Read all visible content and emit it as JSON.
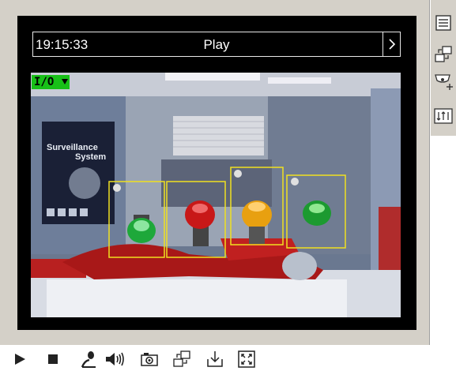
{
  "viewer": {
    "time": "19:15:33",
    "mode": "Play"
  },
  "overlay": {
    "io_label": "I/O"
  },
  "poster": {
    "line1": "Surveillance",
    "line2": "System"
  },
  "sidebar": {
    "items": [
      {
        "icon": "list-icon"
      },
      {
        "icon": "switch-window-icon"
      },
      {
        "icon": "ptz-camera-icon"
      },
      {
        "icon": "io-panel-icon"
      }
    ]
  },
  "toolbar": {
    "buttons": [
      {
        "icon": "play-icon"
      },
      {
        "icon": "stop-icon"
      },
      {
        "icon": "microphone-icon"
      },
      {
        "icon": "speaker-icon"
      },
      {
        "icon": "snapshot-camera-icon"
      },
      {
        "icon": "switch-window-icon"
      },
      {
        "icon": "download-icon"
      },
      {
        "icon": "fullscreen-icon"
      }
    ]
  }
}
